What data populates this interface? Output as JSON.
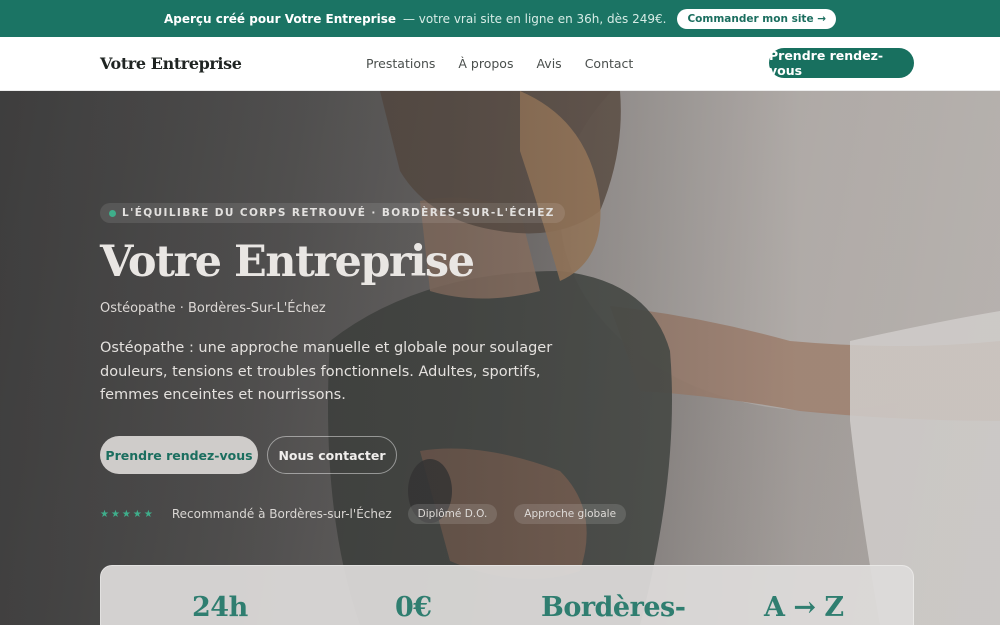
{
  "banner": {
    "lead": "Aperçu créé pour Votre Entreprise",
    "text": "— votre vrai site en ligne en 36h, dès 249€.",
    "cta": "Commander mon site →"
  },
  "nav": {
    "logo": "Votre Entreprise",
    "links": [
      "Prestations",
      "À propos",
      "Avis",
      "Contact"
    ],
    "cta": "Prendre rendez-vous"
  },
  "hero": {
    "eyebrow": "L'ÉQUILIBRE DU CORPS RETROUVÉ · BORDÈRES-SUR-L'ÉCHEZ",
    "title": "Votre Entreprise",
    "subtitle": "Ostéopathe · Bordères-Sur-L'Échez",
    "description": "Ostéopathe : une approche manuelle et globale pour soulager douleurs, tensions et troubles fonctionnels. Adultes, sportifs, femmes enceintes et nourrissons.",
    "primary_cta": "Prendre rendez-vous",
    "secondary_cta": "Nous contacter",
    "stars": "★★★★★",
    "recommendation": "Recommandé à Bordères-sur-l'Échez",
    "chips": [
      "Diplômé D.O.",
      "Approche globale"
    ]
  },
  "stats": [
    "24h",
    "0€",
    "Bordères-",
    "A → Z"
  ],
  "colors": {
    "brand": "#1b7464",
    "accent": "#3fae8b",
    "stat_text": "#2f7e70"
  },
  "icons": {
    "eyebrow_dot": "status-dot-icon",
    "stars": "star-icon",
    "banner_arrow": "arrow-right-icon"
  }
}
